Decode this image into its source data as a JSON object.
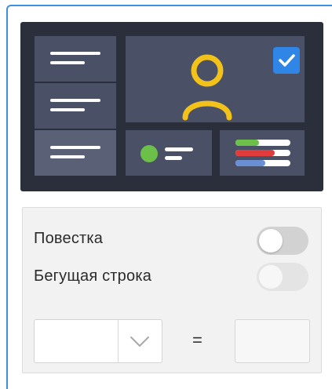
{
  "preview": {
    "checkbox_checked": true,
    "accent_color": "#2f86e6",
    "avatar_color": "#f2c21b",
    "status_dot_color": "#6cc04a",
    "bar_colors": [
      "#6cc04a",
      "#e23b3b",
      "#6a8fd4"
    ],
    "icons": [
      "text-lines-icon",
      "user-avatar-icon",
      "checkmark-icon",
      "status-dot-icon",
      "color-bars-icon"
    ]
  },
  "settings": {
    "agenda_label": "Повестка",
    "agenda_enabled": false,
    "ticker_label": "Бегущая строка",
    "ticker_enabled": false,
    "ticker_disabled": true,
    "select_value": "",
    "equals_sign": "=",
    "result_value": ""
  }
}
